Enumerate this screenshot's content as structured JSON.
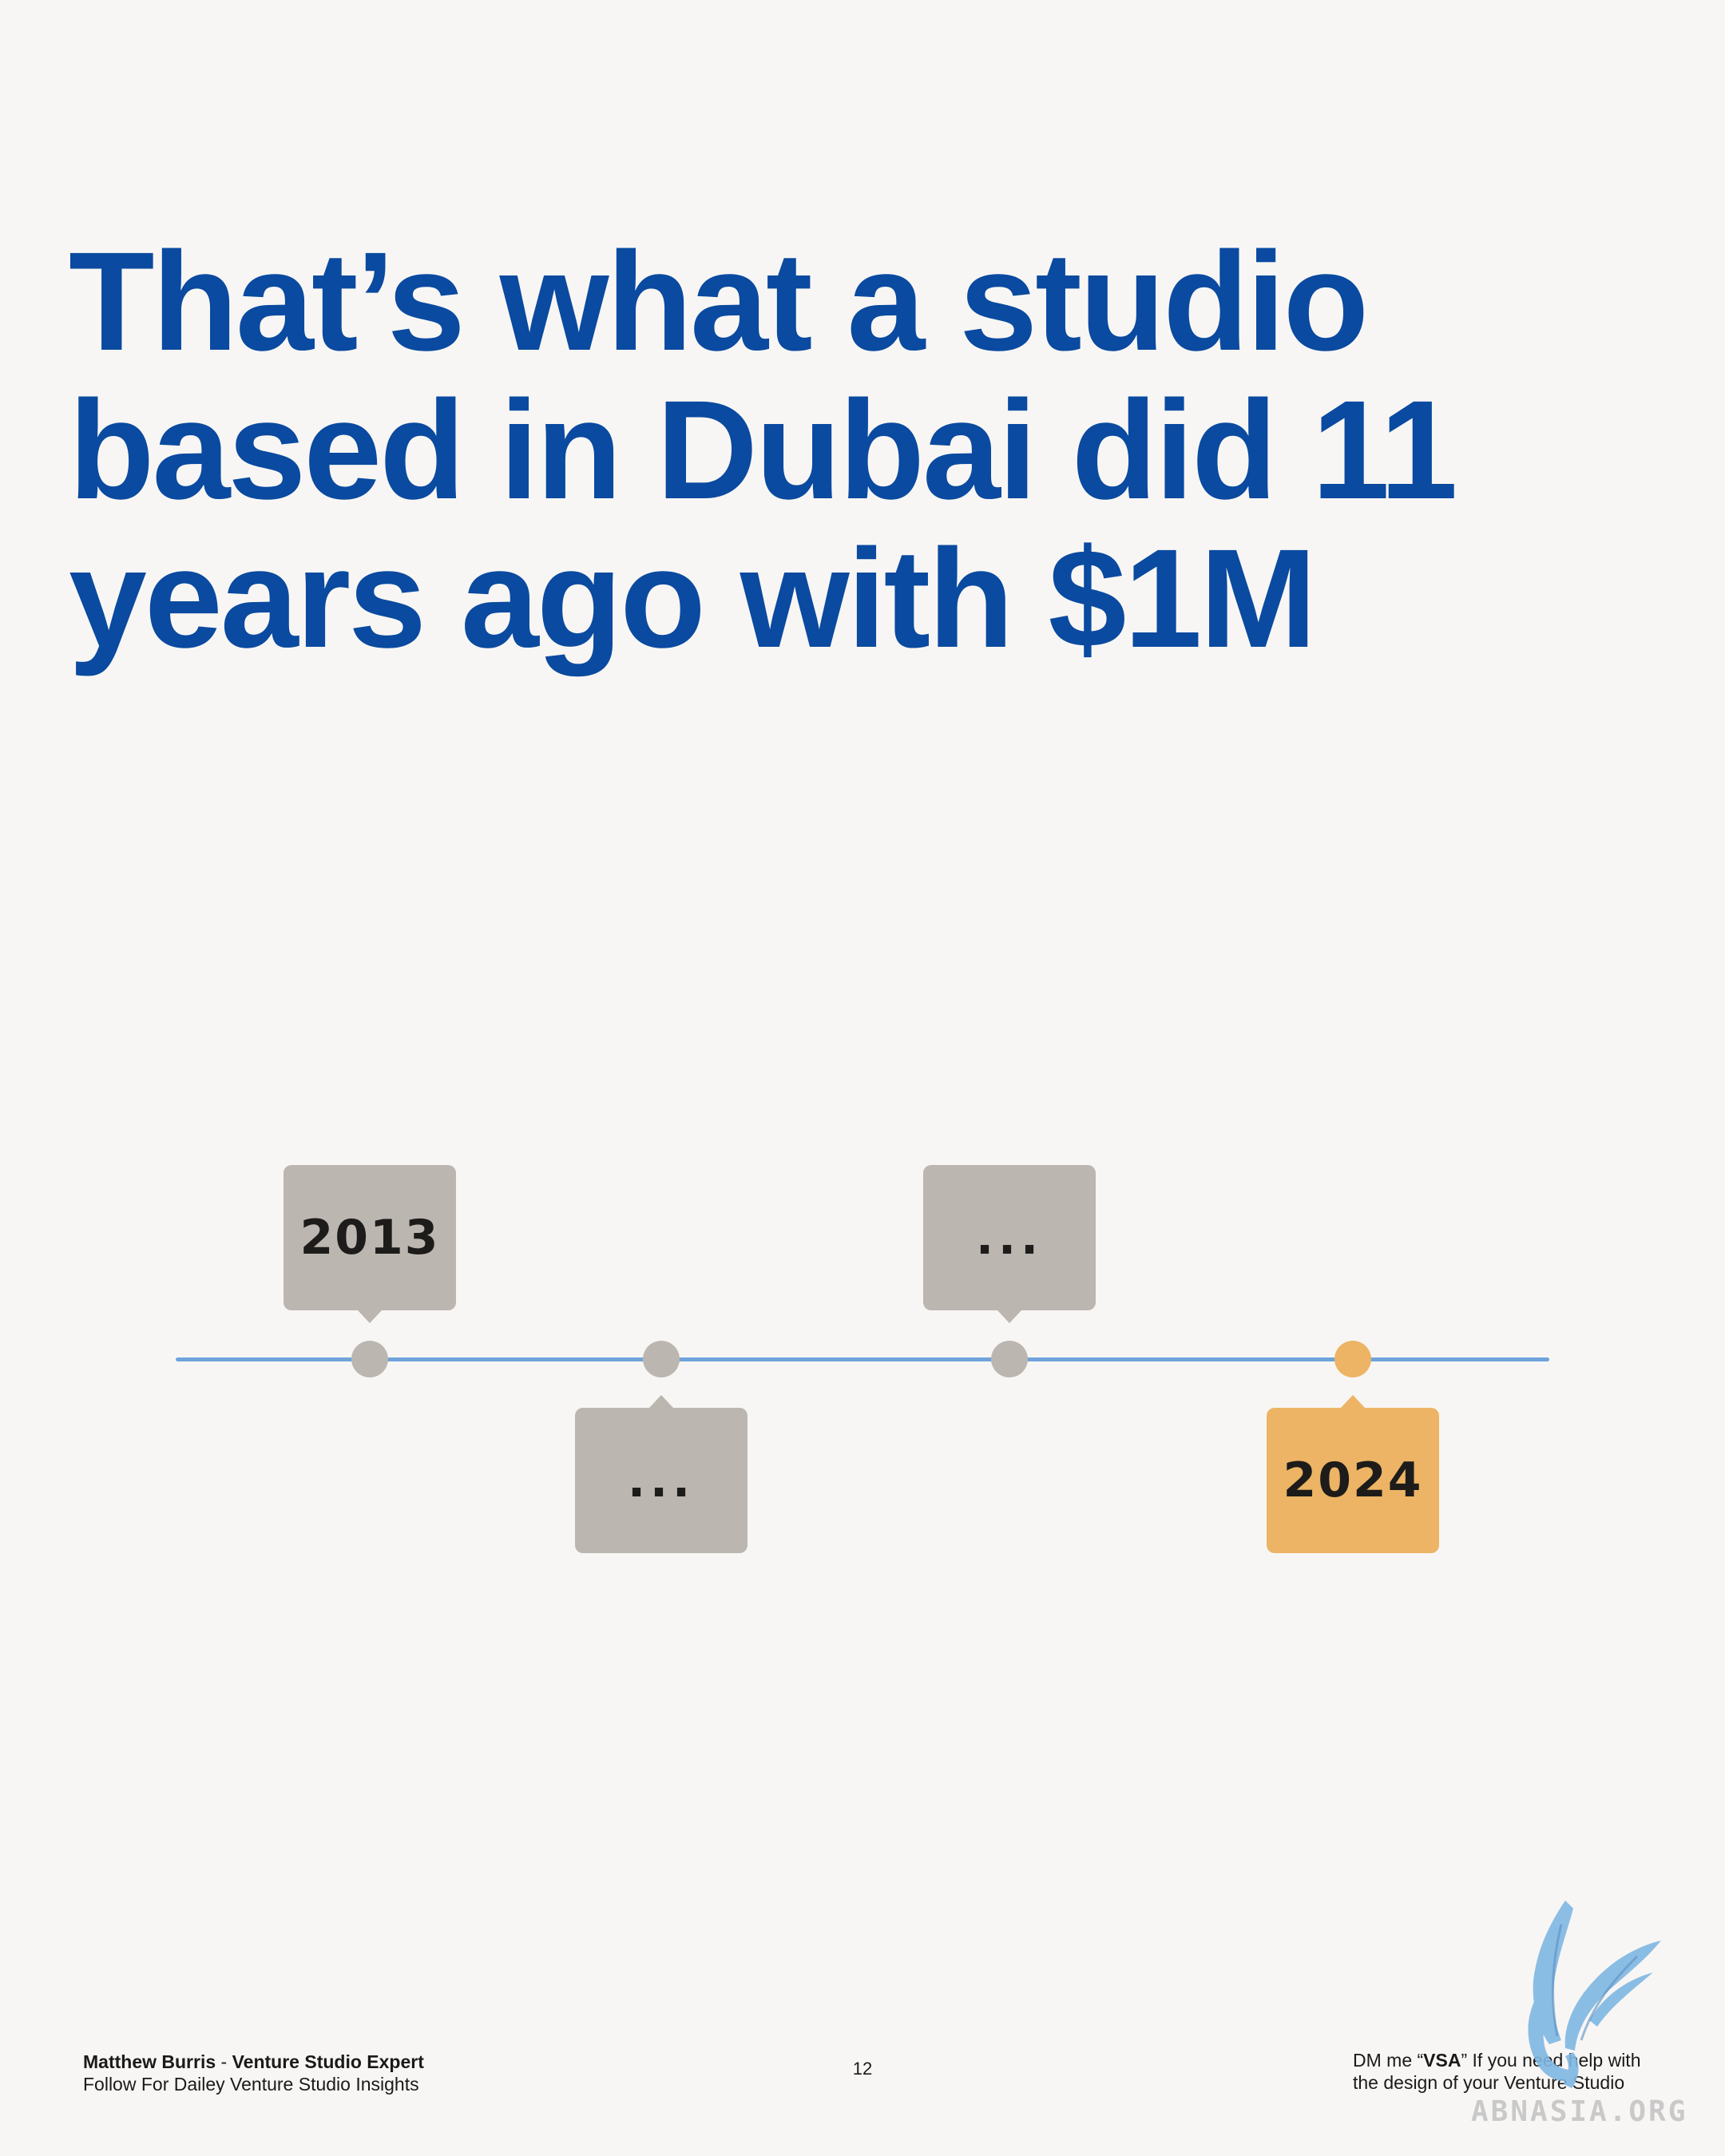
{
  "headline": {
    "lines": [
      "That’s what a studio",
      "based in Dubai did 11",
      "years ago with $1M"
    ]
  },
  "timeline": {
    "axis_color": "#6fa3dc",
    "neutral_color": "#bcb6b0",
    "highlight_color": "#ecb464",
    "milestones": [
      {
        "label": "2013",
        "position": "above",
        "highlight": false
      },
      {
        "label": "...",
        "position": "below",
        "highlight": false
      },
      {
        "label": "...",
        "position": "above",
        "highlight": false
      },
      {
        "label": "2024",
        "position": "below",
        "highlight": true
      }
    ]
  },
  "footer": {
    "author": "Matthew Burris",
    "author_role": "Venture Studio Expert",
    "tagline": "Follow For Dailey Venture Studio Insights",
    "page_number": "12",
    "cta_prefix": "DM me “",
    "cta_keyword": "VSA",
    "cta_suffix": "” If you need help with",
    "cta_line2": "the design of your Venture Studio"
  },
  "watermark": "ABNASIA.ORG"
}
